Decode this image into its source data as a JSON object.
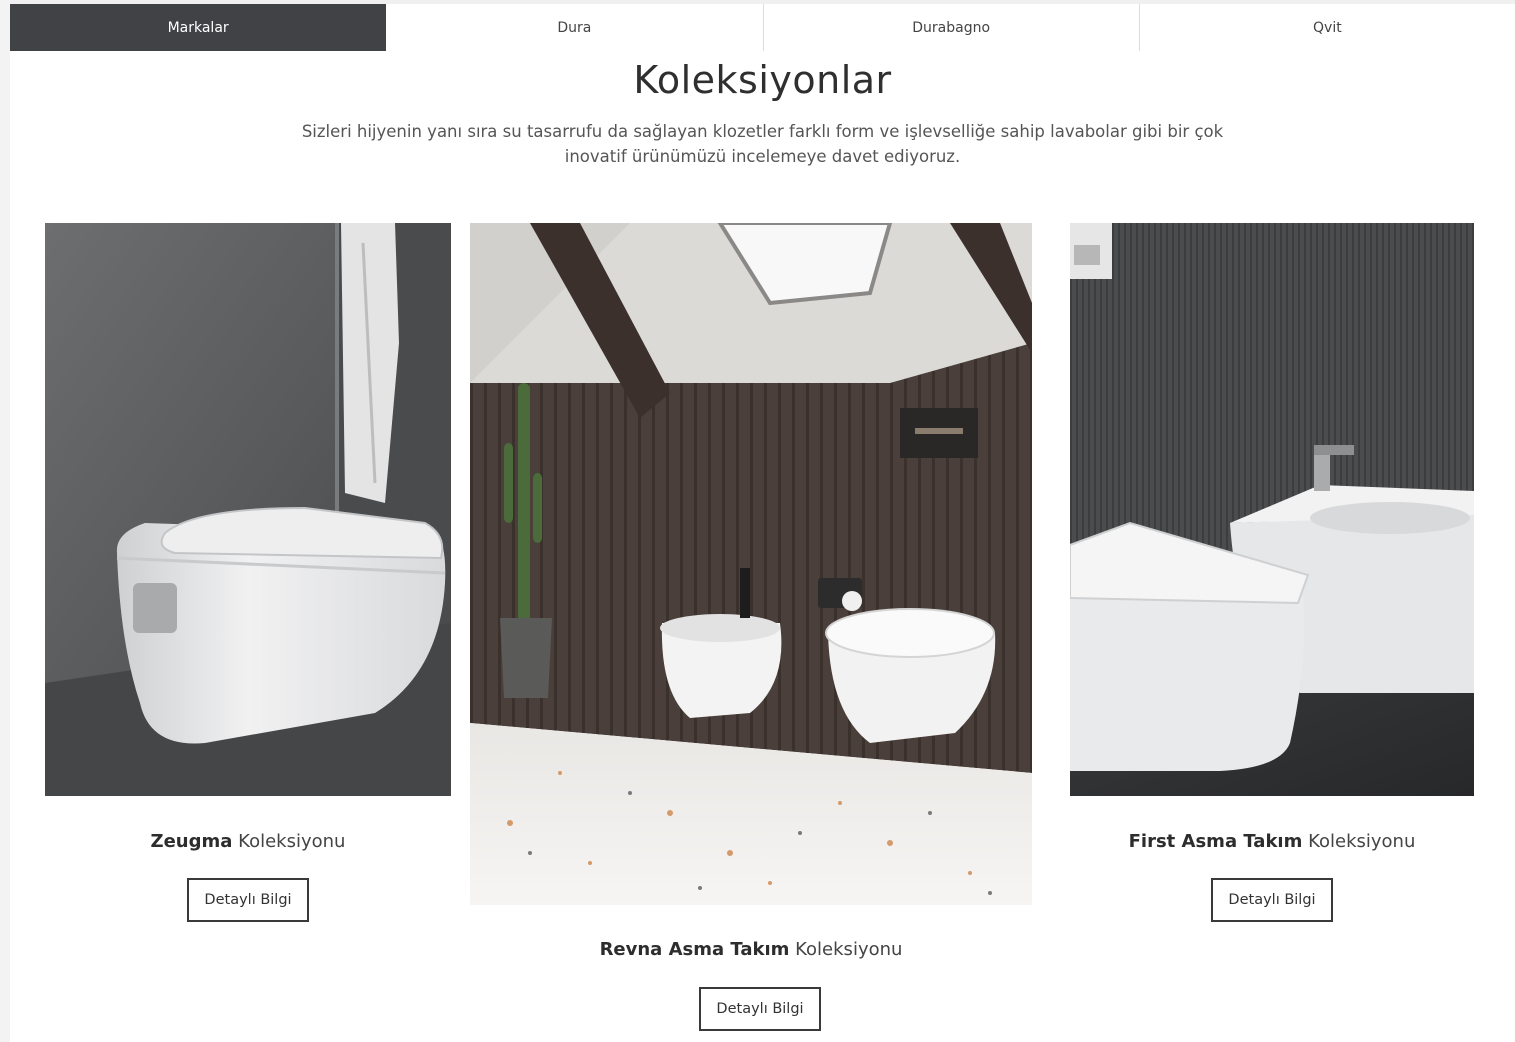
{
  "tabs": [
    {
      "label": "Markalar",
      "active": true
    },
    {
      "label": "Dura",
      "active": false
    },
    {
      "label": "Durabagno",
      "active": false
    },
    {
      "label": "Qvit",
      "active": false
    }
  ],
  "section": {
    "title": "Koleksiyonlar",
    "description": "Sizleri hijyenin yanı sıra su tasarrufu da sağlayan klozetler farklı form ve işlevselliğe sahip lavabolar gibi bir çok inovatif ürünümüzü incelemeye davet ediyoruz."
  },
  "collections": [
    {
      "name": "Zeugma",
      "suffix": "Koleksiyonu",
      "button": "Detaylı Bilgi"
    },
    {
      "name": "Revna Asma Takım",
      "suffix": "Koleksiyonu",
      "button": "Detaylı Bilgi"
    },
    {
      "name": "First Asma Takım",
      "suffix": "Koleksiyonu",
      "button": "Detaylı Bilgi"
    }
  ],
  "colors": {
    "active_tab_bg": "#414246",
    "button_border": "#3a3a3a",
    "page_bg": "#ffffff"
  }
}
